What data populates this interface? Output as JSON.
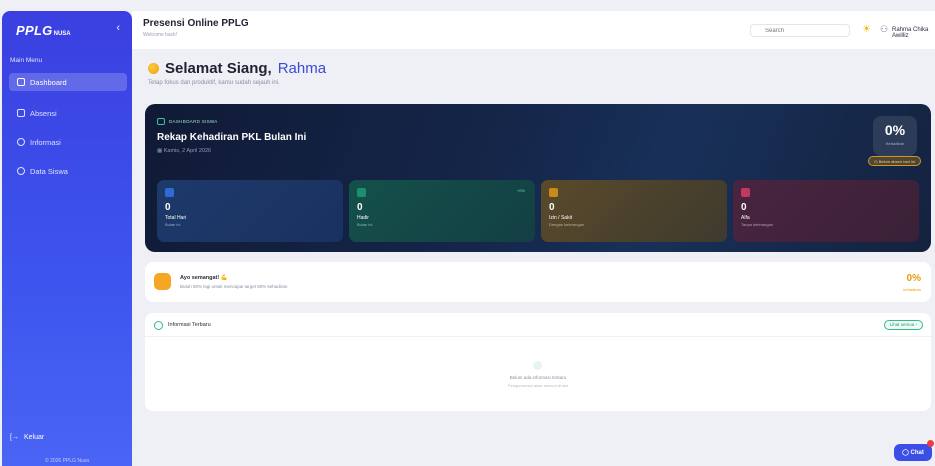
{
  "sidebar": {
    "brand": "PPLG",
    "brand_suffix": "NUSA",
    "collapse_glyph": "‹",
    "menu_title": "Main Menu",
    "items": [
      {
        "label": "Dashboard",
        "icon": "grid-icon",
        "active": true
      },
      {
        "label": "Absensi",
        "icon": "calendar-icon",
        "active": false
      },
      {
        "label": "Informasi",
        "icon": "message-icon",
        "active": false
      },
      {
        "label": "Data Siswa",
        "icon": "users-icon",
        "active": false
      }
    ],
    "logout": "Keluar",
    "copyright": "© 2026 PPLG Nusa"
  },
  "topbar": {
    "title": "Presensi Online PPLG",
    "subtitle": "Welcome back!",
    "search_placeholder": "Search",
    "user_name": "Rahma Chika Awilliz"
  },
  "greeting": {
    "prefix": "Selamat Siang,",
    "name": "Rahma",
    "subtitle": "Tetap fokus dan produktif, kamu sudah sejauh ini."
  },
  "hero": {
    "badge": "DASHBOARD SISWA",
    "title": "Rekap Kehadiran PKL Bulan Ini",
    "date": "Kamis, 2 April 2026",
    "percent": "0%",
    "percent_label": "Kehadiran",
    "warning": "Belum absen hari ini",
    "stats": [
      {
        "value": "0",
        "label": "Total Hari",
        "sub": "Bulan ini"
      },
      {
        "value": "0",
        "label": "Hadir",
        "sub": "Bulan ini",
        "delta": "+0%"
      },
      {
        "value": "0",
        "label": "Izin / Sakit",
        "sub": "Dengan keterangan"
      },
      {
        "value": "0",
        "label": "Alfa",
        "sub": "Tanpa keterangan"
      }
    ]
  },
  "motivation": {
    "title": "Ayo semangat! 💪",
    "text": "Butuh 80% lagi untuk mencapai target 80% kehadiran.",
    "percent": "0%",
    "percent_label": "kehadiran"
  },
  "info": {
    "title": "Informasi Terbaru",
    "more": "Lihat semua ›",
    "empty_title": "Belum ada informasi terbaru",
    "empty_sub": "Pengumuman akan muncul di sini"
  },
  "chat": {
    "label": "◯ Chat"
  },
  "colors": {
    "accent": "#3b4fe6",
    "warning": "#f5a623",
    "success": "#35b88a"
  }
}
